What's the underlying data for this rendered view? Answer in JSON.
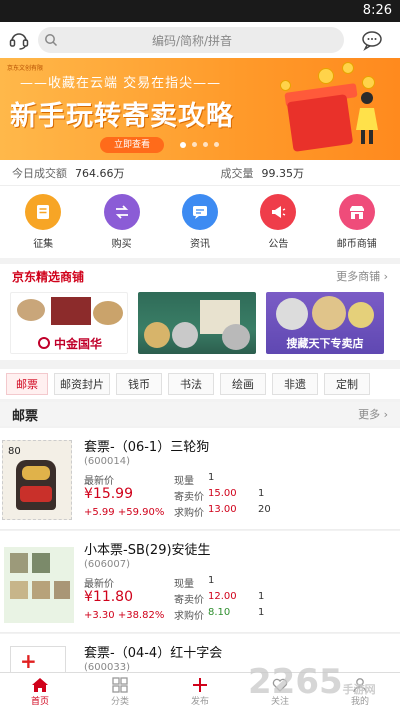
{
  "status": {
    "time": "8:26"
  },
  "search": {
    "placeholder": "编码/简称/拼音"
  },
  "banner": {
    "tag": "京东文创有限",
    "subtitle": "——收藏在云端  交易在指尖——",
    "headline": "新手玩转寄卖攻略",
    "cta": "立即查看"
  },
  "stats": {
    "today_label": "今日成交额",
    "today_value": "764.66万",
    "volume_label": "成交量",
    "volume_value": "99.35万"
  },
  "quick_icons": [
    {
      "label": "征集",
      "icon": "collect-icon",
      "color": "#f7a525"
    },
    {
      "label": "购买",
      "icon": "buy-icon",
      "color": "#8b5cd6"
    },
    {
      "label": "资讯",
      "icon": "news-icon",
      "color": "#3d8bf2"
    },
    {
      "label": "公告",
      "icon": "announcement-icon",
      "color": "#ef3d4a"
    },
    {
      "label": "邮币商铺",
      "icon": "shop-icon",
      "color": "#ef4c7a"
    }
  ],
  "shops": {
    "title": "京东精选商铺",
    "more": "更多商铺 ›",
    "cards": [
      {
        "caption": "中金国华"
      },
      {
        "caption": ""
      },
      {
        "caption": "搜藏天下专卖店"
      }
    ]
  },
  "categories": [
    "邮票",
    "邮资封片",
    "钱币",
    "书法",
    "绘画",
    "非遗",
    "定制"
  ],
  "section": {
    "title": "邮票",
    "more": "更多 ›"
  },
  "items": [
    {
      "name": "套票-（06-1）三轮狗",
      "code": "(600014)",
      "latest_label": "最新价",
      "price": "¥15.99",
      "change": "+5.99  +59.90%",
      "stock_label": "现量",
      "stock": "1",
      "sell_label": "寄卖价",
      "sell_price": "15.00",
      "sell_qty": "1",
      "buy_label": "求购价",
      "buy_price": "13.00",
      "buy_qty": "20"
    },
    {
      "name": "小本票-SB(29)安徒生",
      "code": "(606007)",
      "latest_label": "最新价",
      "price": "¥11.80",
      "change": "+3.30  +38.82%",
      "stock_label": "现量",
      "stock": "1",
      "sell_label": "寄卖价",
      "sell_price": "12.00",
      "sell_qty": "1",
      "buy_label": "求购价",
      "buy_price": "8.10",
      "buy_qty": "1"
    },
    {
      "name": "套票-（04-4）红十字会",
      "code": "(600033)"
    }
  ],
  "tabs": [
    "首页",
    "分类",
    "发布",
    "关注",
    "我的"
  ],
  "watermark": {
    "big": "2265",
    "small": "手游网"
  }
}
